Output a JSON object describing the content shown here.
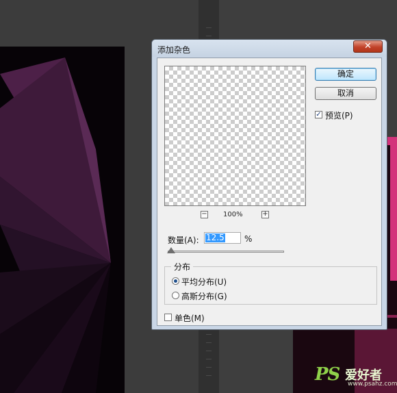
{
  "dialog": {
    "title": "添加杂色",
    "close_glyph": "✕",
    "ok_label": "确定",
    "cancel_label": "取消",
    "preview_label": "预览(P)",
    "preview_checked": true,
    "zoom_out_glyph": "−",
    "zoom_in_glyph": "+",
    "zoom_level": "100%",
    "amount_label": "数量(A):",
    "amount_value": "12.5",
    "amount_unit": "%",
    "amount_slider_fraction": 0.0,
    "distribution_legend": "分布",
    "uniform_label": "平均分布(U)",
    "gaussian_label": "高斯分布(G)",
    "selected_distribution": "uniform",
    "monochromatic_label": "单色(M)",
    "monochromatic_checked": false,
    "check_glyph": "✓"
  },
  "watermark": {
    "logo": "PS",
    "text": "爱好者",
    "url": "www.psahz.com"
  },
  "colors": {
    "dialog_frame": "#c9d6e6",
    "ok_button": "#bee6fd",
    "close_button": "#c2422a",
    "selection": "#3399ff",
    "canvas_purple": "#4a2145",
    "canvas_pink": "#d3337b"
  },
  "icons": {
    "close": "close-icon",
    "zoom_out": "minus-icon",
    "zoom_in": "plus-icon",
    "check": "check-icon"
  }
}
